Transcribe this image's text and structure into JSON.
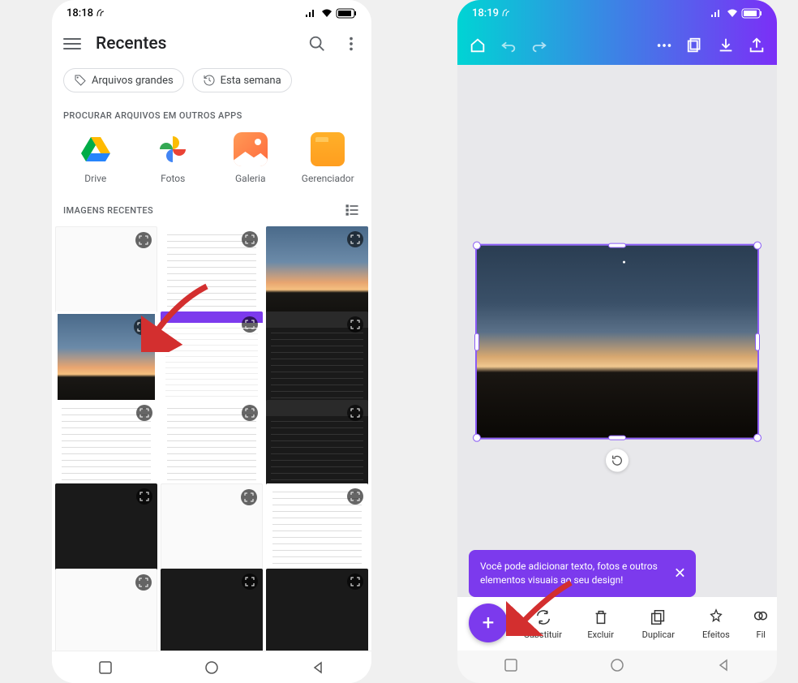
{
  "left": {
    "status_time": "18:18",
    "header_title": "Recentes",
    "chip_large": "Arquivos grandes",
    "chip_week": "Esta semana",
    "section_apps": "PROCURAR ARQUIVOS EM OUTROS APPS",
    "apps": {
      "drive": "Drive",
      "fotos": "Fotos",
      "galeria": "Galeria",
      "gerenciador": "Gerenciador"
    },
    "section_images": "IMAGENS RECENTES"
  },
  "right": {
    "status_time": "18:19",
    "tooltip_text": "Você pode adicionar texto, fotos e outros elementos visuais ao seu design!",
    "toolbar": {
      "substituir": "Substituir",
      "excluir": "Excluir",
      "duplicar": "Duplicar",
      "efeitos": "Efeitos",
      "filtros": "Fil"
    }
  }
}
